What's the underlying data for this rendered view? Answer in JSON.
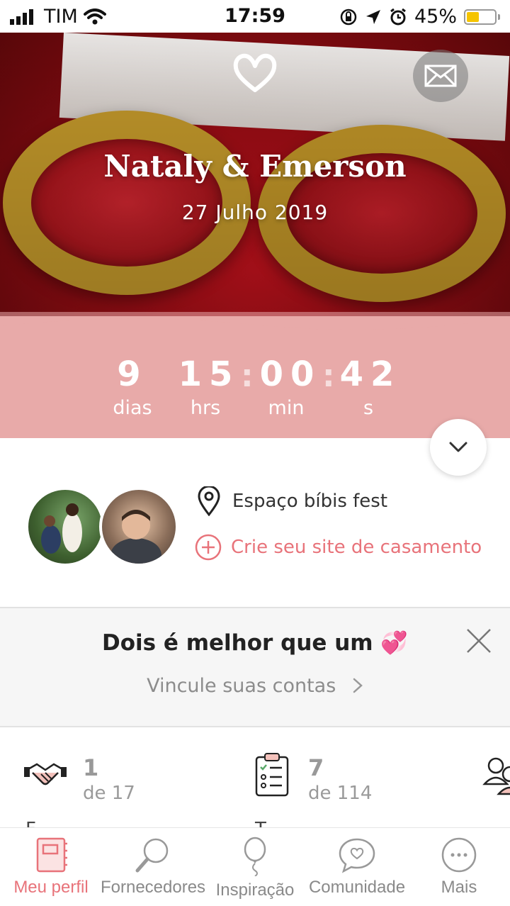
{
  "status_bar": {
    "carrier": "TIM",
    "time": "17:59",
    "battery_percent": "45%",
    "battery_level": 0.45
  },
  "hero": {
    "couple_names": "Nataly & Emerson",
    "wedding_date": "27 Julho 2019"
  },
  "countdown": {
    "days": "9",
    "hours": "15",
    "minutes": "00",
    "seconds": "42",
    "days_label": "dias",
    "hours_label": "hrs",
    "minutes_label": "min",
    "seconds_label": "s"
  },
  "info": {
    "venue": "Espaço bíbis fest",
    "create_site": "Crie seu site de casamento"
  },
  "promo": {
    "title": "Dois é melhor que um 💞",
    "link": "Vincule suas contas"
  },
  "stats": [
    {
      "value": "1",
      "total": "de 17"
    },
    {
      "value": "7",
      "total": "de 114"
    }
  ],
  "tabs": [
    {
      "label": "Meu perfil",
      "icon": "notebook-icon",
      "active": true
    },
    {
      "label": "Fornecedores",
      "icon": "search-icon",
      "active": false
    },
    {
      "label": "Inspiração",
      "icon": "balloon-icon",
      "active": false
    },
    {
      "label": "Comunidade",
      "icon": "chat-heart-icon",
      "active": false
    },
    {
      "label": "Mais",
      "icon": "more-icon",
      "active": false
    }
  ],
  "colors": {
    "accent": "#e8737a",
    "countdown_band": "#e8aaa9"
  }
}
